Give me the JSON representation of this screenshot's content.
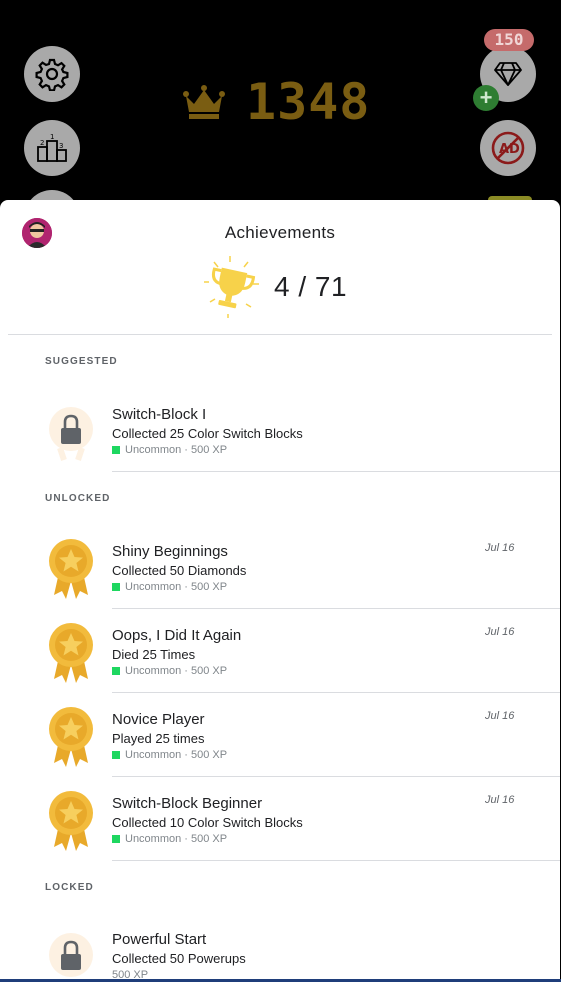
{
  "game": {
    "score": "1348",
    "gem_count": "150",
    "plus_label": "+",
    "colors": {
      "score": "#7a5d12",
      "button_grey": "#a9a9a9",
      "badge": "#c56b6b"
    },
    "buttons": [
      "gear-icon",
      "leaderboard-podium-icon",
      "diamond-icon",
      "no-ads-icon"
    ]
  },
  "sheet": {
    "title": "Achievements",
    "progress": "4 / 71",
    "sections": {
      "suggested": "SUGGESTED",
      "unlocked": "UNLOCKED",
      "locked": "LOCKED"
    },
    "suggested": [
      {
        "name": "Switch-Block I",
        "desc": "Collected 25 Color Switch Blocks",
        "meta": "Uncommon · 500 XP",
        "icon": "lock-icon"
      }
    ],
    "unlocked": [
      {
        "name": "Shiny Beginnings",
        "desc": "Collected 50 Diamonds",
        "meta": "Uncommon · 500 XP",
        "date": "Jul 16",
        "icon": "medal-icon"
      },
      {
        "name": "Oops, I Did It Again",
        "desc": "Died 25 Times",
        "meta": "Uncommon · 500 XP",
        "date": "Jul 16",
        "icon": "medal-icon"
      },
      {
        "name": "Novice Player",
        "desc": "Played 25 times",
        "meta": "Uncommon · 500 XP",
        "date": "Jul 16",
        "icon": "medal-icon"
      },
      {
        "name": "Switch-Block Beginner",
        "desc": "Collected 10 Color Switch Blocks",
        "meta": "Uncommon · 500 XP",
        "date": "Jul 16",
        "icon": "medal-icon"
      }
    ],
    "locked": [
      {
        "name": "Powerful Start",
        "desc": "Collected 50 Powerups",
        "meta": "500 XP",
        "icon": "lock-icon"
      }
    ],
    "colors": {
      "rarity_uncommon": "#1ed760",
      "medal_gold": "#f2bb3c",
      "trophy_yellow": "#f7d24a"
    }
  }
}
